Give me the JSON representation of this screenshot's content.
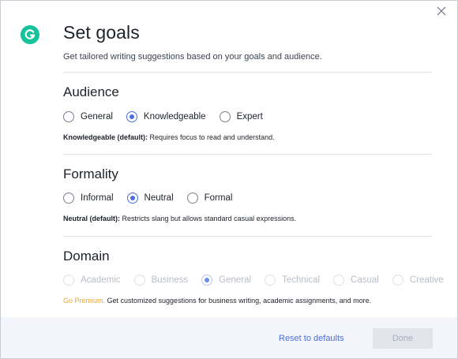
{
  "header": {
    "title": "Set goals",
    "subtitle": "Get tailored writing suggestions based on your goals and audience."
  },
  "audience": {
    "title": "Audience",
    "options": [
      {
        "label": "General",
        "checked": false
      },
      {
        "label": "Knowledgeable",
        "checked": true
      },
      {
        "label": "Expert",
        "checked": false
      }
    ],
    "desc_bold": "Knowledgeable (default):",
    "desc_text": " Requires focus to read and understand."
  },
  "formality": {
    "title": "Formality",
    "options": [
      {
        "label": "Informal",
        "checked": false
      },
      {
        "label": "Neutral",
        "checked": true
      },
      {
        "label": "Formal",
        "checked": false
      }
    ],
    "desc_bold": "Neutral (default):",
    "desc_text": " Restricts slang but allows standard casual expressions."
  },
  "domain": {
    "title": "Domain",
    "options": [
      {
        "label": "Academic",
        "checked": false
      },
      {
        "label": "Business",
        "checked": false
      },
      {
        "label": "General",
        "checked": true
      },
      {
        "label": "Technical",
        "checked": false
      },
      {
        "label": "Casual",
        "checked": false
      },
      {
        "label": "Creative",
        "checked": false
      }
    ],
    "premium_link": "Go Premium.",
    "premium_text": " Get customized suggestions for business writing, academic assignments, and more."
  },
  "footer": {
    "reset_label": "Reset to defaults",
    "done_label": "Done"
  },
  "colors": {
    "brand": "#15c39a",
    "accent": "#4a6ee0",
    "premium": "#e9a825"
  },
  "icons": {
    "close": "close-icon",
    "logo": "grammarly-logo-icon"
  }
}
